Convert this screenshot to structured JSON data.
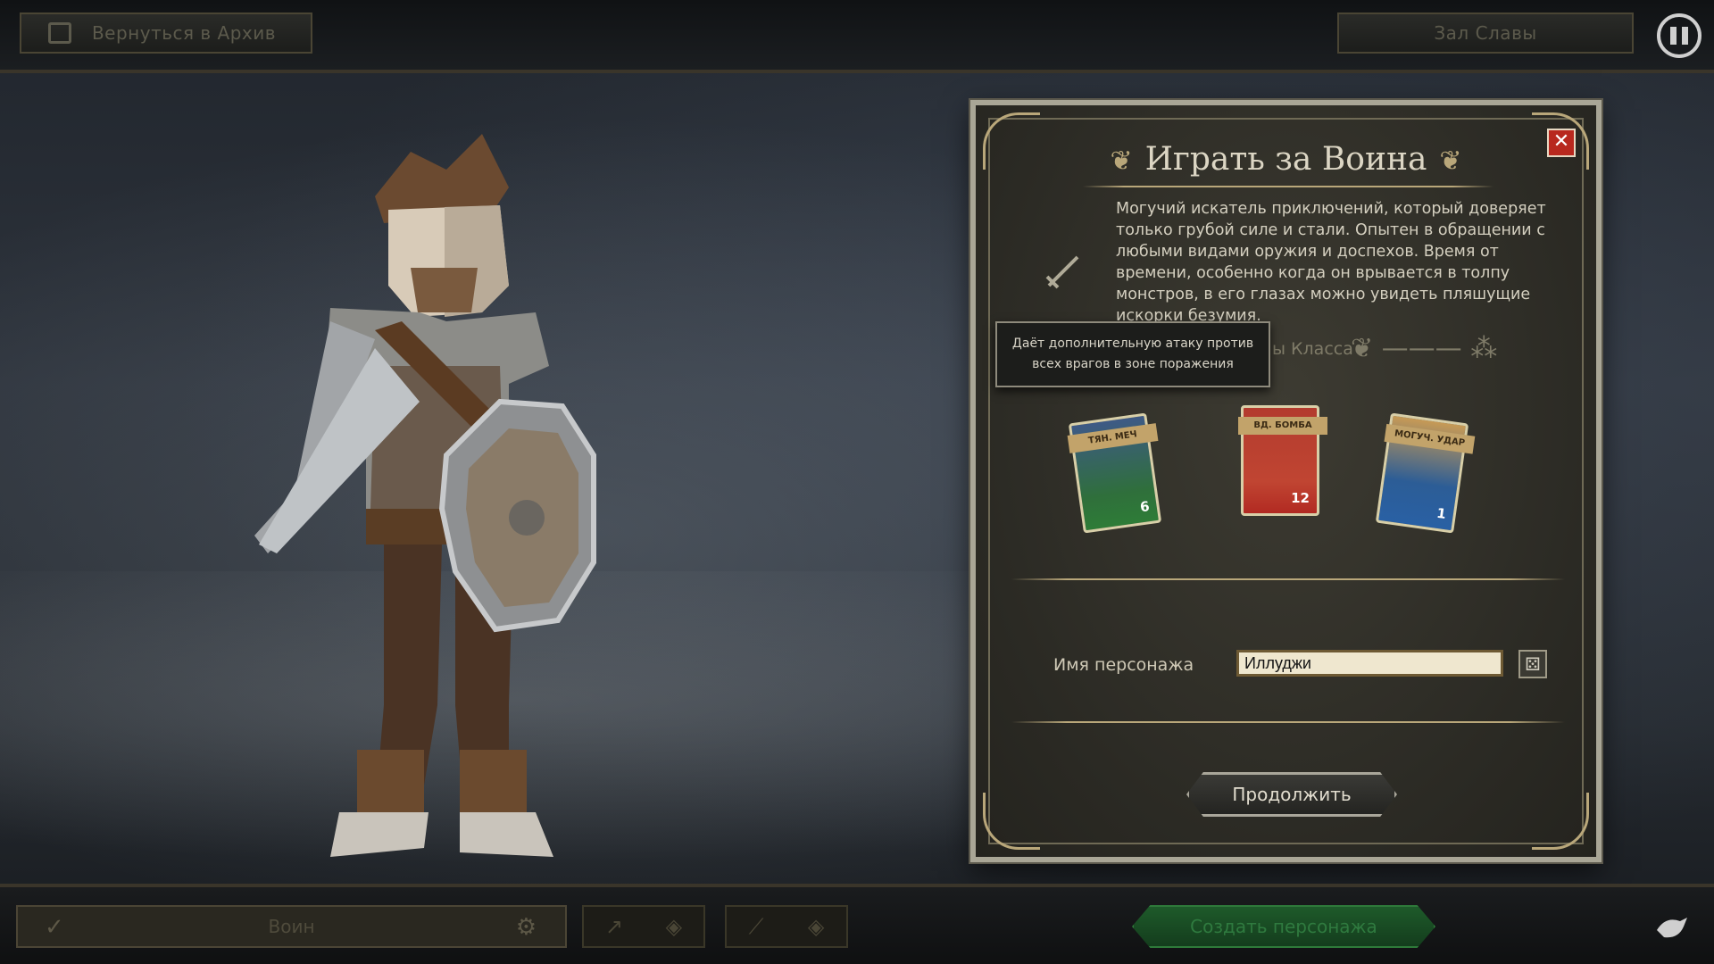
{
  "topbar": {
    "back_label": "Вернуться в Архив",
    "hall_label": "Зал Славы"
  },
  "panel": {
    "title": "Играть за Воина",
    "description": "Могучий искатель приключений, который доверяет только грубой силе и стали. Опытен в обращении с любыми видами оружия и доспехов. Время от времени, особенно когда он врывается в толпу монстров, в его глазах можно увидеть пляшущие искорки безумия.",
    "skills_label_partial": "ы Класса",
    "tooltip": "Даёт дополнительную атаку против всех врагов в зоне поражения",
    "cards": [
      {
        "label": "ТЯН. МЕЧ",
        "value": "6",
        "color": "#2e7c37"
      },
      {
        "label": "ВД. БОМБА",
        "value": "12",
        "color": "#b22a22"
      },
      {
        "label": "МОГУЧ. УДАР",
        "value": "1",
        "color": "#2960a4"
      }
    ],
    "name_label": "Имя персонажа",
    "name_value": "Иллуджи",
    "continue_label": "Продолжить"
  },
  "bottombar": {
    "class_label": "Воин",
    "create_label": "Создать персонажа"
  },
  "colors": {
    "accent_gold": "#b9a77a",
    "close_red": "#b8281e",
    "create_green": "#1e5a2a"
  },
  "icons": {
    "back": "book-icon",
    "pause": "pause-icon",
    "close": "close-icon",
    "class": "sword-icon",
    "dice": "dice-icon",
    "check": "check-icon",
    "gear": "gear-icon",
    "logo": "bird-logo-icon"
  }
}
